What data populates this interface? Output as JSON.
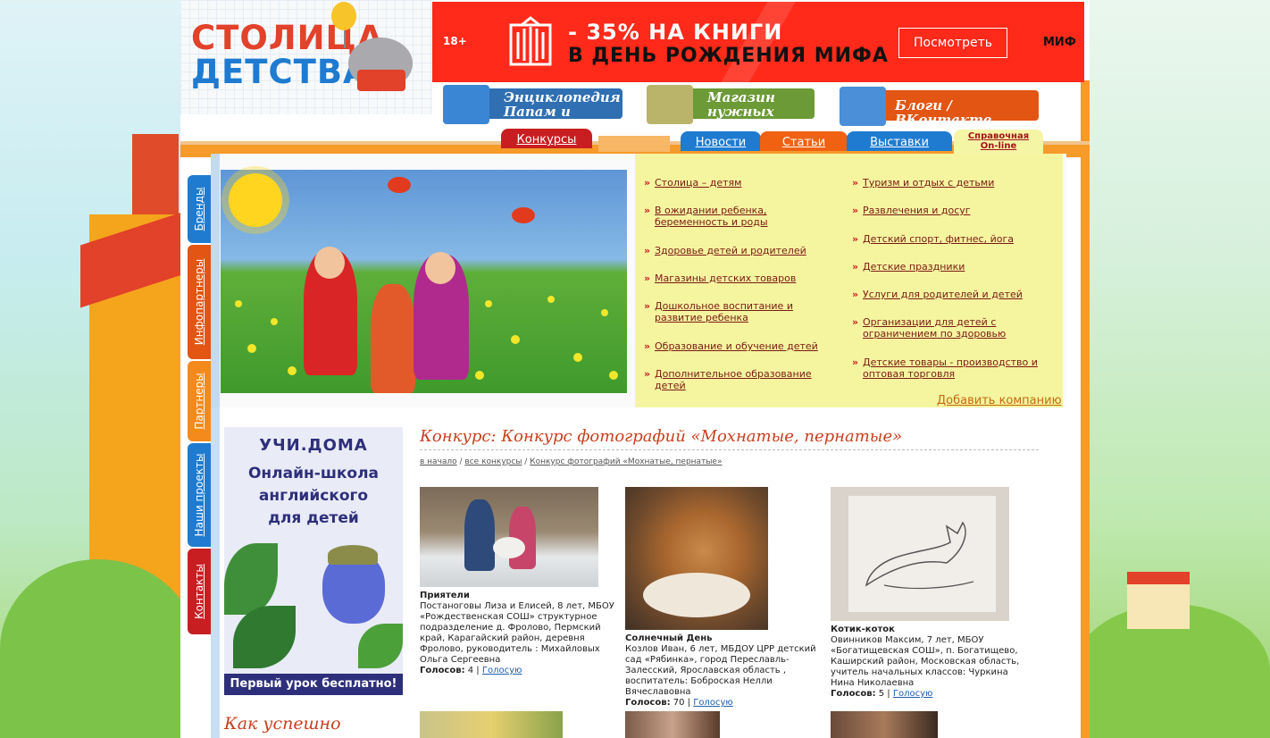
{
  "logo": {
    "line1": "СТОЛИЦА",
    "line2": "ДЕТСТВА"
  },
  "banner": {
    "age": "18+",
    "line1": "- 35% НА КНИГИ",
    "line2": "В ДЕНЬ РОЖДЕНИЯ МИФА",
    "button": "Посмотреть",
    "brand": "МИФ",
    "color": "#ff2a1a"
  },
  "quick_links": [
    {
      "line1": "Энциклопедия",
      "line2": "Папам и Мамам"
    },
    {
      "line1": "Магазин",
      "line2": "нужных вещей"
    },
    {
      "line1": "Блоги / ВКонтакте"
    }
  ],
  "tabs": {
    "contests": "Конкурсы",
    "news": "Новости",
    "articles": "Статьи",
    "exhibitions": "Выставки",
    "help1": "Справочная",
    "help2": "On-line"
  },
  "side_tabs": [
    "Бренды",
    "Инфопартнеры",
    "Партнеры",
    "Наши проекты",
    "Контакты"
  ],
  "catalog": {
    "left": [
      "Столица – детям",
      "В ожидании ребенка, беременность и роды",
      "Здоровье детей и родителей",
      "Магазины детских товаров",
      "Дошкольное воспитание и развитие ребенка",
      "Образование и обучение детей",
      "Дополнительное образование детей"
    ],
    "right": [
      "Туризм и отдых с детьми",
      "Развлечения и досуг",
      "Детский спорт, фитнес, йога",
      "Детские праздники",
      "Услуги для родителей и детей",
      "Организации для детей с ограничением по здоровью",
      "Детские товары - производство и оптовая торговля"
    ],
    "add_company": "Добавить компанию"
  },
  "ad": {
    "logo": "УЧИ.ДОМА",
    "text1": "Онлайн-школа",
    "text2": "английского",
    "text3": "для детей",
    "footer": "Первый урок бесплатно!"
  },
  "howto": "Как успешно",
  "page": {
    "title": "Конкурс: Конкурс фотографий «Мохнатые, пернатые»",
    "crumb_home": "в начало",
    "crumb_all": "все конкурсы",
    "crumb_current": "Конкурс фотографий «Мохнатые, пернатые»",
    "sep": " / "
  },
  "entries": [
    {
      "name": "Приятели",
      "desc": "Постаноговы Лиза и Елисей, 8 лет, МБОУ «Рождественская СОШ» структурное подразделение д. Фролово, Пермский край, Карагайский район, деревня Фролово, руководитель : Михайловых Ольга Сергеевна",
      "votes_label": "Голосов:",
      "votes": "4",
      "vote": "Голосую"
    },
    {
      "name": "Солнечный День",
      "desc": "Козлов Иван, 6 лет, МБДОУ ЦРР детский сад «Рябинка», город Переславль-Залесский, Ярославская область , воспитатель: Боброская Нелли Вячеславовна",
      "votes_label": "Голосов:",
      "votes": "70",
      "vote": "Голосую"
    },
    {
      "name": "Котик-коток",
      "desc": "Овинников Максим, 7 лет, МБОУ «Богатищевская СОШ», п. Богатищево, Каширский район, Московская область, учитель начальных классов: Чуркина Нина Николаевна",
      "votes_label": "Голосов:",
      "votes": "5",
      "vote": "Голосую"
    }
  ],
  "vote_sep": " | "
}
